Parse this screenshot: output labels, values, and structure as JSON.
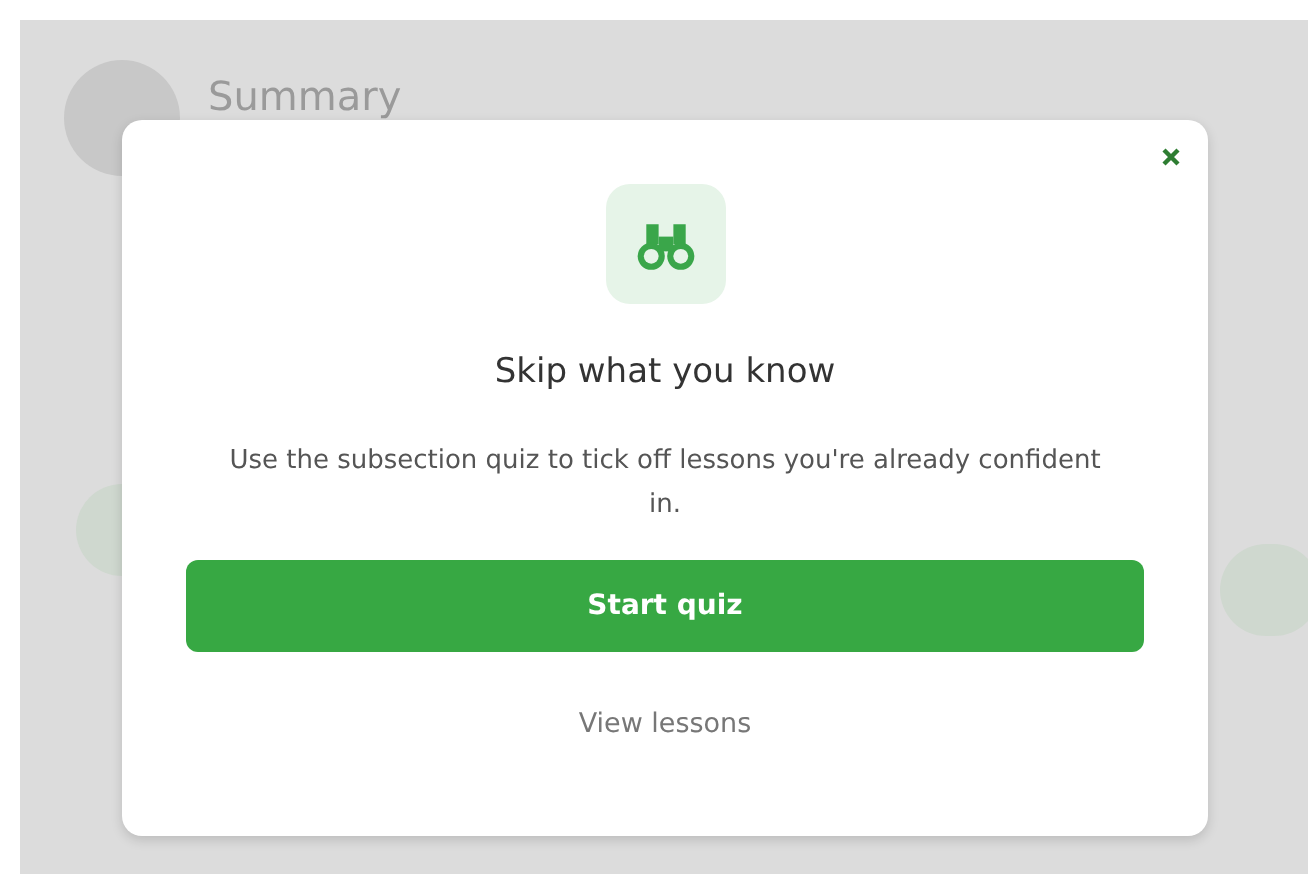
{
  "background": {
    "title": "Summary"
  },
  "dialog": {
    "title": "Skip what you know",
    "description": "Use the subsection quiz to tick off lessons you're already confident in.",
    "primary_button": "Start quiz",
    "secondary_link": "View lessons"
  }
}
